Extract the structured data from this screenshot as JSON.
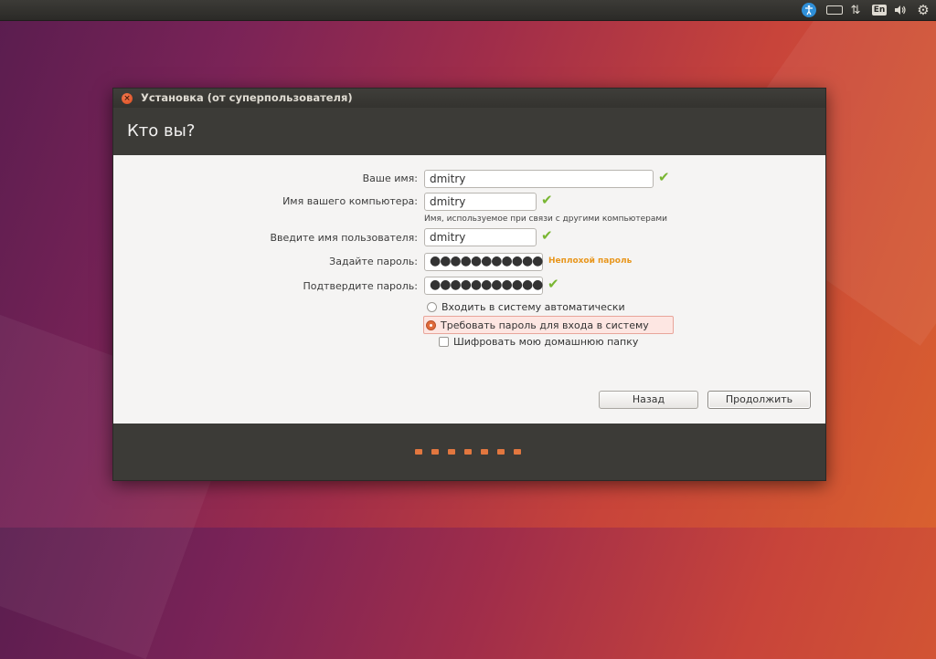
{
  "top_panel": {
    "icons": [
      "accessibility-icon",
      "battery-icon",
      "network-icon",
      "keyboard-layout-icon",
      "volume-icon",
      "gear-icon"
    ],
    "keyboard_layout": "En"
  },
  "window": {
    "title": "Установка (от суперпользователя)",
    "heading": "Кто вы?"
  },
  "form": {
    "name_label": "Ваше имя:",
    "name_value": "dmitry",
    "computer_label": "Имя вашего компьютера:",
    "computer_value": "dmitry",
    "computer_hint": "Имя, используемое при связи с другими компьютерами",
    "username_label": "Введите имя пользователя:",
    "username_value": "dmitry",
    "password_label": "Задайте пароль:",
    "password_value": "●●●●●●●●●●●",
    "password_strength": "Неплохой пароль",
    "confirm_label": "Подтвердите пароль:",
    "confirm_value": "●●●●●●●●●●●",
    "auto_login_label": "Входить в систему автоматически",
    "require_password_label": "Требовать пароль для входа в систему",
    "encrypt_home_label": "Шифровать мою домашнюю папку",
    "selected_login_option": "require_password",
    "encrypt_home_checked": false
  },
  "buttons": {
    "back": "Назад",
    "continue": "Продолжить"
  },
  "progress": {
    "steps": 7
  },
  "colors": {
    "accent": "#e2773f",
    "valid": "#79b632",
    "warning": "#e8961c"
  }
}
